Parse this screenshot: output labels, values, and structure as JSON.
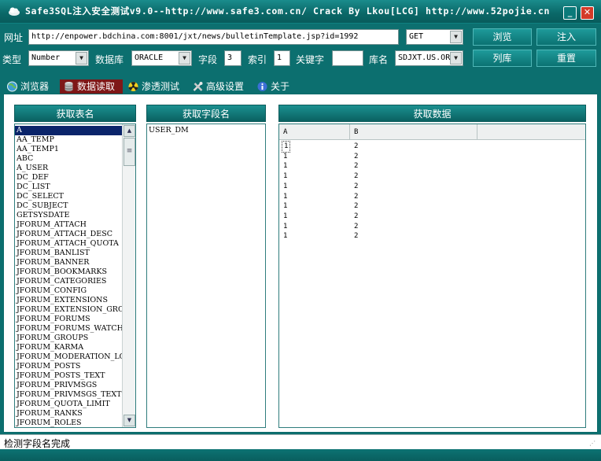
{
  "window": {
    "title": "Safe3SQL注入安全测试v9.0--http://www.safe3.com.cn/  Crack By Lkou[LCG]  http://www.52pojie.cn",
    "min_label": "_",
    "close_label": "✕"
  },
  "toolbar": {
    "url_label": "网址",
    "url_value": "http://enpower.bdchina.com:8001/jxt/news/bulletinTemplate.jsp?id=1992",
    "method_value": "GET",
    "browse_button": "浏览",
    "inject_button": "注入",
    "type_label": "类型",
    "type_value": "Number",
    "db_label": "数据库",
    "db_value": "ORACLE",
    "field_label": "字段",
    "field_value": "3",
    "index_label": "索引",
    "index_value": "1",
    "keyword_label": "关键字",
    "keyword_value": "",
    "dbname_label": "库名",
    "dbname_value": "SDJXT.US.OR",
    "list_db_button": "列库",
    "reset_button": "重置"
  },
  "tabs": [
    {
      "label": "浏览器"
    },
    {
      "label": "数据读取"
    },
    {
      "label": "渗透测试"
    },
    {
      "label": "高级设置"
    },
    {
      "label": "关于"
    }
  ],
  "panels": {
    "tables_header": "获取表名",
    "fields_header": "获取字段名",
    "data_header": "获取数据"
  },
  "tables": [
    "A",
    "AA_TEMP",
    "AA_TEMP1",
    "ABC",
    "A_USER",
    "DC_DEF",
    "DC_LIST",
    "DC_SELECT",
    "DC_SUBJECT",
    "GETSYSDATE",
    "JFORUM_ATTACH",
    "JFORUM_ATTACH_DESC",
    "JFORUM_ATTACH_QUOTA",
    "JFORUM_BANLIST",
    "JFORUM_BANNER",
    "JFORUM_BOOKMARKS",
    "JFORUM_CATEGORIES",
    "JFORUM_CONFIG",
    "JFORUM_EXTENSIONS",
    "JFORUM_EXTENSION_GROUPS",
    "JFORUM_FORUMS",
    "JFORUM_FORUMS_WATCH",
    "JFORUM_GROUPS",
    "JFORUM_KARMA",
    "JFORUM_MODERATION_LOG",
    "JFORUM_POSTS",
    "JFORUM_POSTS_TEXT",
    "JFORUM_PRIVMSGS",
    "JFORUM_PRIVMSGS_TEXT",
    "JFORUM_QUOTA_LIMIT",
    "JFORUM_RANKS",
    "JFORUM_ROLES"
  ],
  "fields": [
    "USER_DM"
  ],
  "data_grid": {
    "columns": [
      "A",
      "B"
    ],
    "rows": [
      [
        "1",
        "2"
      ],
      [
        "1",
        "2"
      ],
      [
        "1",
        "2"
      ],
      [
        "1",
        "2"
      ],
      [
        "1",
        "2"
      ],
      [
        "1",
        "2"
      ],
      [
        "1",
        "2"
      ],
      [
        "1",
        "2"
      ],
      [
        "1",
        "2"
      ],
      [
        "1",
        "2"
      ]
    ]
  },
  "status": {
    "text": "检测字段名完成"
  },
  "colors": {
    "frame": "#0c6f6f",
    "active_tab": "#7e1717",
    "selection": "#0a246a",
    "close": "#d43a28"
  }
}
